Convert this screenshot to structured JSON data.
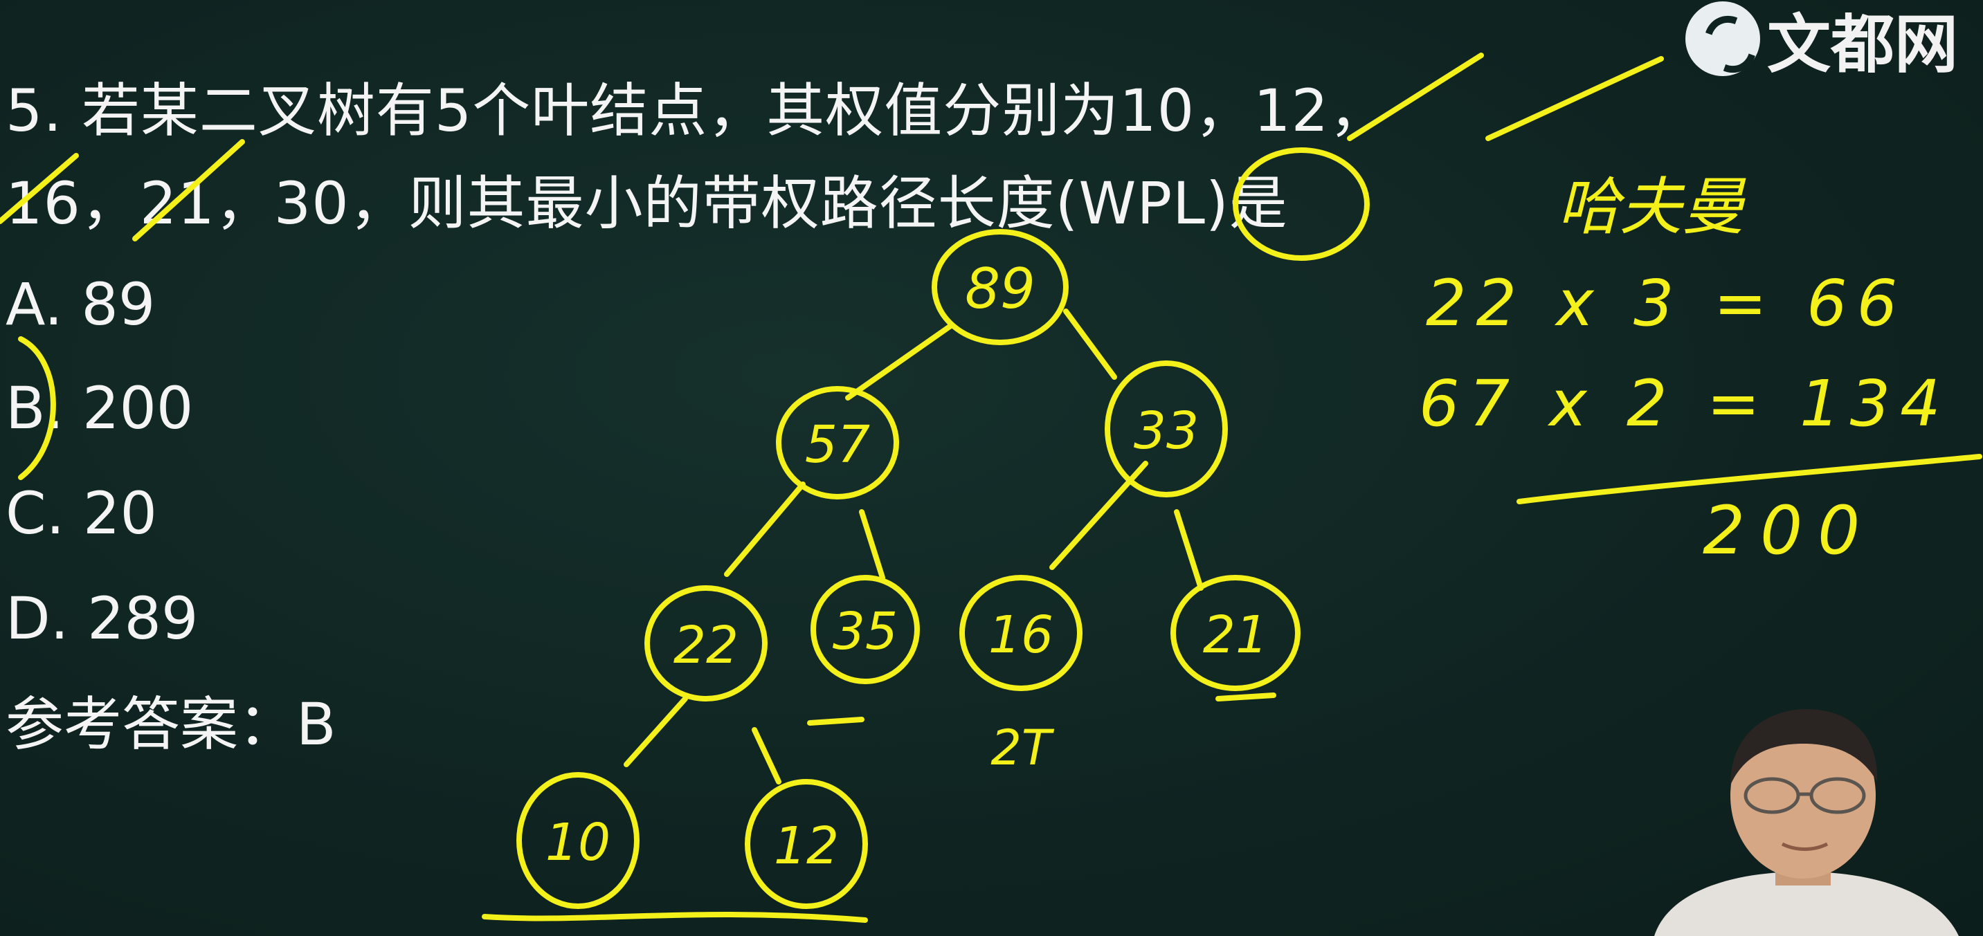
{
  "logo": {
    "text": "文都网"
  },
  "question": {
    "line1": "5. 若某二叉树有5个叶结点，其权值分别为10，12，",
    "line2": "16，21，30，则其最小的带权路径长度(WPL)是"
  },
  "options": [
    {
      "label": "A. 89"
    },
    {
      "label": "B. 200"
    },
    {
      "label": "C.  20"
    },
    {
      "label": "D. 289"
    }
  ],
  "answer": "参考答案：B",
  "tree": {
    "nodes": [
      "89",
      "57",
      "33",
      "22",
      "35",
      "16",
      "21",
      "10",
      "12"
    ],
    "level_marks": [
      "2T"
    ]
  },
  "notes": {
    "title": "哈夫曼",
    "line1": "22 x 3 = 66",
    "line2": "67 x 2 = 134",
    "total": "200"
  },
  "colors": {
    "board": "#0f2421",
    "chalk_text": "#f4f4f4",
    "marker": "#f3f01a"
  }
}
